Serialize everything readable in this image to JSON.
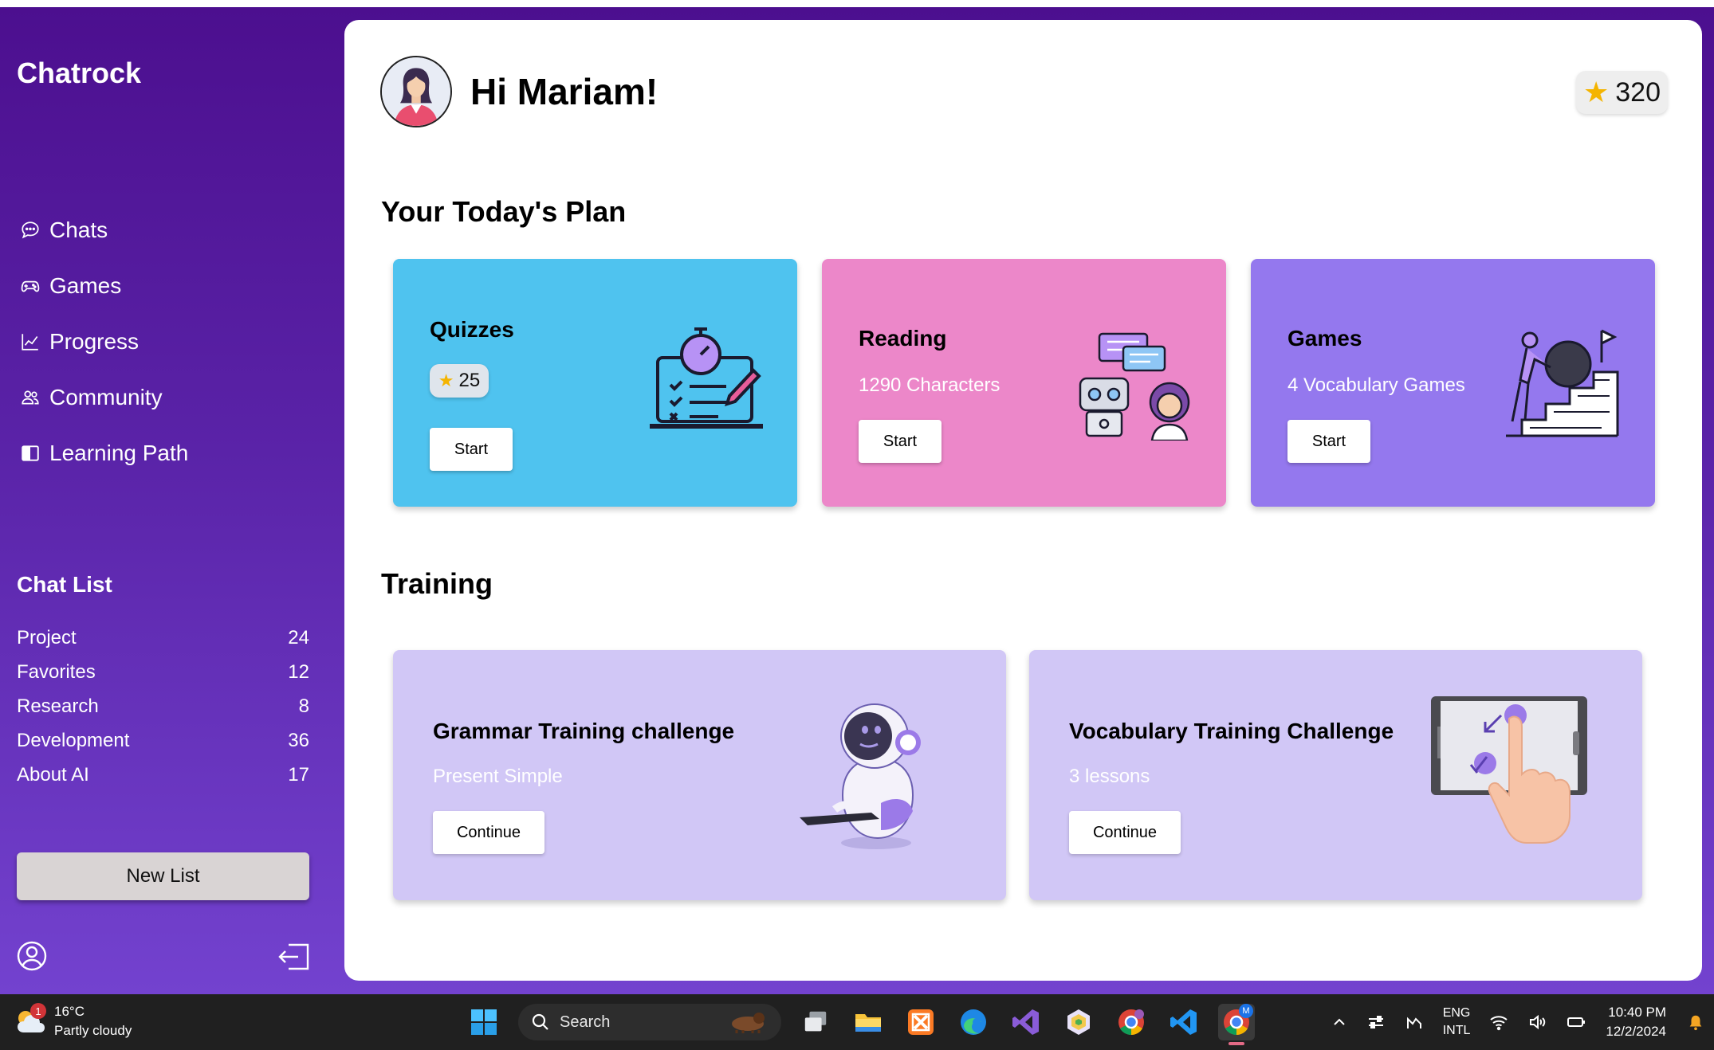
{
  "app": {
    "brand": "Chatrock",
    "accent_gradient": [
      "#4c0f8f",
      "#7342cf"
    ]
  },
  "sidebar": {
    "nav": [
      {
        "label": "Chats",
        "icon": "chat-bubble-icon"
      },
      {
        "label": "Games",
        "icon": "gamepad-icon"
      },
      {
        "label": "Progress",
        "icon": "chart-line-icon"
      },
      {
        "label": "Community",
        "icon": "people-icon"
      },
      {
        "label": "Learning Path",
        "icon": "book-icon"
      }
    ],
    "chat_list_title": "Chat List",
    "chat_list": [
      {
        "label": "Project",
        "count": "24"
      },
      {
        "label": "Favorites",
        "count": "12"
      },
      {
        "label": "Research",
        "count": "8"
      },
      {
        "label": "Development",
        "count": "36"
      },
      {
        "label": "About AI",
        "count": "17"
      }
    ],
    "new_list_label": "New List"
  },
  "header": {
    "greeting": "Hi Mariam!",
    "points": "320"
  },
  "plan": {
    "title": "Your Today's Plan",
    "cards": [
      {
        "title": "Quizzes",
        "points": "25",
        "button": "Start",
        "color": "#4fc3ef"
      },
      {
        "title": "Reading",
        "subtitle": "1290 Characters",
        "button": "Start",
        "color": "#ec87c9"
      },
      {
        "title": "Games",
        "subtitle": "4 Vocabulary Games",
        "button": "Start",
        "color": "#9478ee"
      }
    ]
  },
  "training": {
    "title": "Training",
    "cards": [
      {
        "title": "Grammar Training challenge",
        "subtitle": "Present Simple",
        "button": "Continue"
      },
      {
        "title": "Vocabulary Training Challenge",
        "subtitle": "3 lessons",
        "button": "Continue"
      }
    ]
  },
  "taskbar": {
    "weather_temp": "16°C",
    "weather_desc": "Partly cloudy",
    "weather_badge": "1",
    "search_label": "Search",
    "lang_top": "ENG",
    "lang_bottom": "INTL",
    "time": "10:40 PM",
    "date": "12/2/2024",
    "chrome_badge": "M"
  }
}
